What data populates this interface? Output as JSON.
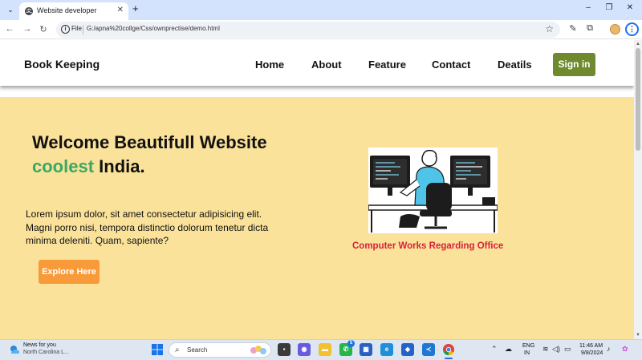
{
  "browser": {
    "tab_title": "Website developer",
    "new_tab_symbol": "+",
    "omnibox_scheme": "File",
    "url": "G:/apna%20collge/Css/ownprectise/demo.html",
    "icons": [
      "tab-search-icon",
      "globe-icon",
      "close-icon",
      "back-icon",
      "forward-icon",
      "reload-icon",
      "info-icon",
      "star-icon",
      "eyedropper-icon",
      "extensions-icon",
      "profile-avatar",
      "menu-icon",
      "minimize-icon",
      "restore-icon",
      "window-close-icon"
    ]
  },
  "site": {
    "brand": "Book Keeping",
    "nav": [
      "Home",
      "About",
      "Feature",
      "Contact",
      "Deatils"
    ],
    "signin_label": "Sign in",
    "hero": {
      "title_line1": "Welcome Beautifull Website",
      "title_accent": "coolest",
      "title_rest": " India.",
      "text": "Lorem ipsum dolor, sit amet consectetur adipisicing elit. Magni porro nisi, tempora distinctio dolorum tenetur dicta minima deleniti. Quam, sapiente?",
      "button_label": "Explore Here",
      "image_caption": "Computer Works Regarding Office"
    },
    "colors": {
      "hero_bg": "#fae29a",
      "accent_green": "#3aa864",
      "signin_bg": "#6f8a2e",
      "explore_bg": "#f89a3a",
      "caption_red": "#d81f3a"
    }
  },
  "taskbar": {
    "news_title": "News for you",
    "news_sub": "North Carolina L...",
    "search_label": "Search",
    "whatsapp_badge": "5",
    "lang_line1": "ENG",
    "lang_line2": "IN",
    "time": "11:46 AM",
    "date": "9/8/2024"
  }
}
